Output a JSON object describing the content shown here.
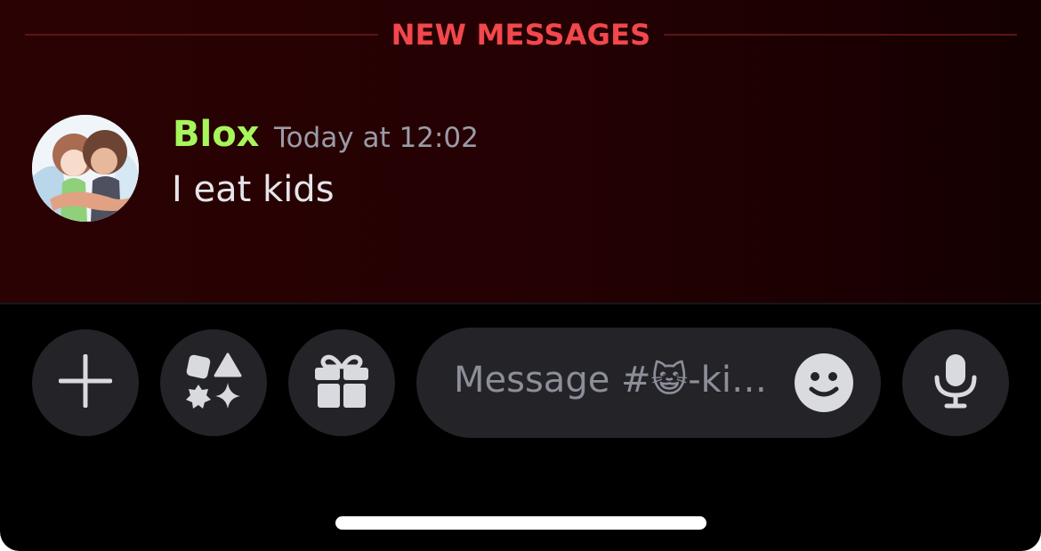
{
  "divider": {
    "label": "NEW MESSAGES",
    "color": "#f2474c"
  },
  "message": {
    "author": "Blox",
    "author_color": "#a6f65b",
    "timestamp": "Today at 12:02",
    "content": "I eat kids"
  },
  "toolbar": {
    "add_icon": "plus-icon",
    "apps_icon": "apps-shapes-icon",
    "gift_icon": "gift-icon",
    "emoji_icon": "smiley-icon",
    "voice_icon": "microphone-icon"
  },
  "composer": {
    "placeholder": "Message #😺-ki…"
  }
}
